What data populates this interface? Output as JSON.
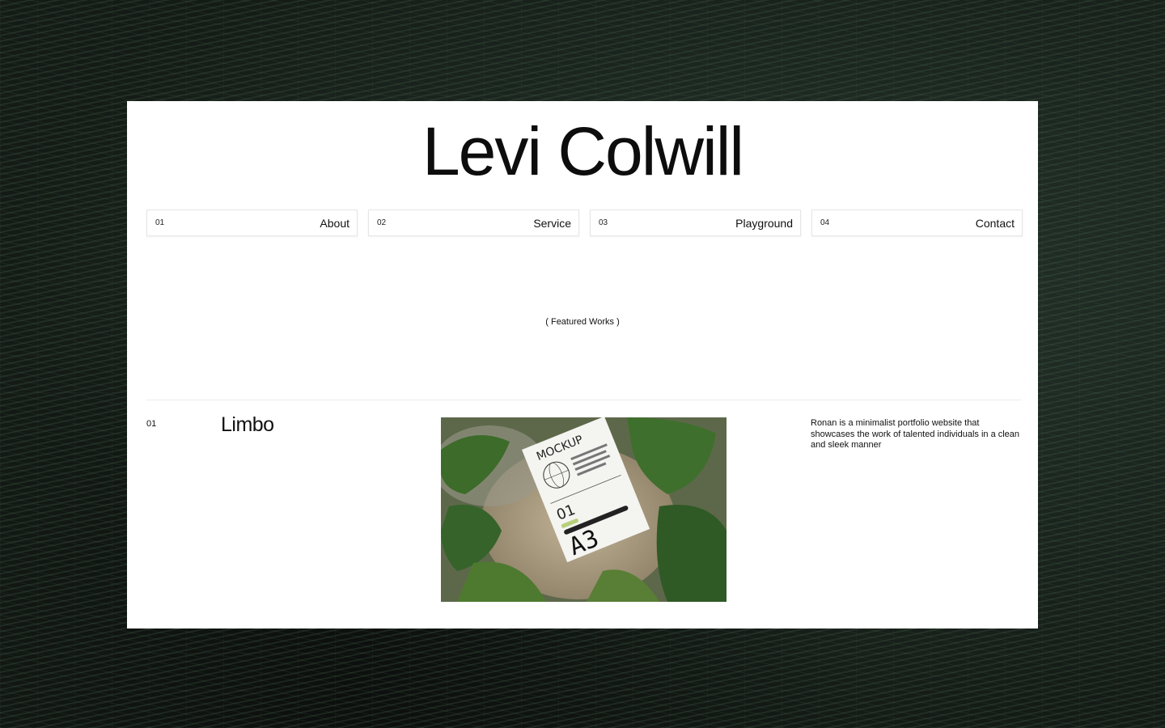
{
  "site": {
    "brand": "Levi Colwill"
  },
  "nav": [
    {
      "num": "01",
      "label": "About"
    },
    {
      "num": "02",
      "label": "Service"
    },
    {
      "num": "03",
      "label": "Playground"
    },
    {
      "num": "04",
      "label": "Contact"
    }
  ],
  "featured": {
    "heading": "( Featured Works )"
  },
  "works": [
    {
      "num": "01",
      "title": "Limbo",
      "description": "Ronan is a minimalist portfolio website that showcases the work of talented individuals in a clean and sleek manner",
      "image": {
        "mockup_label": "MOCKUP",
        "mockup_number": "01",
        "mockup_size": "A3"
      }
    }
  ]
}
